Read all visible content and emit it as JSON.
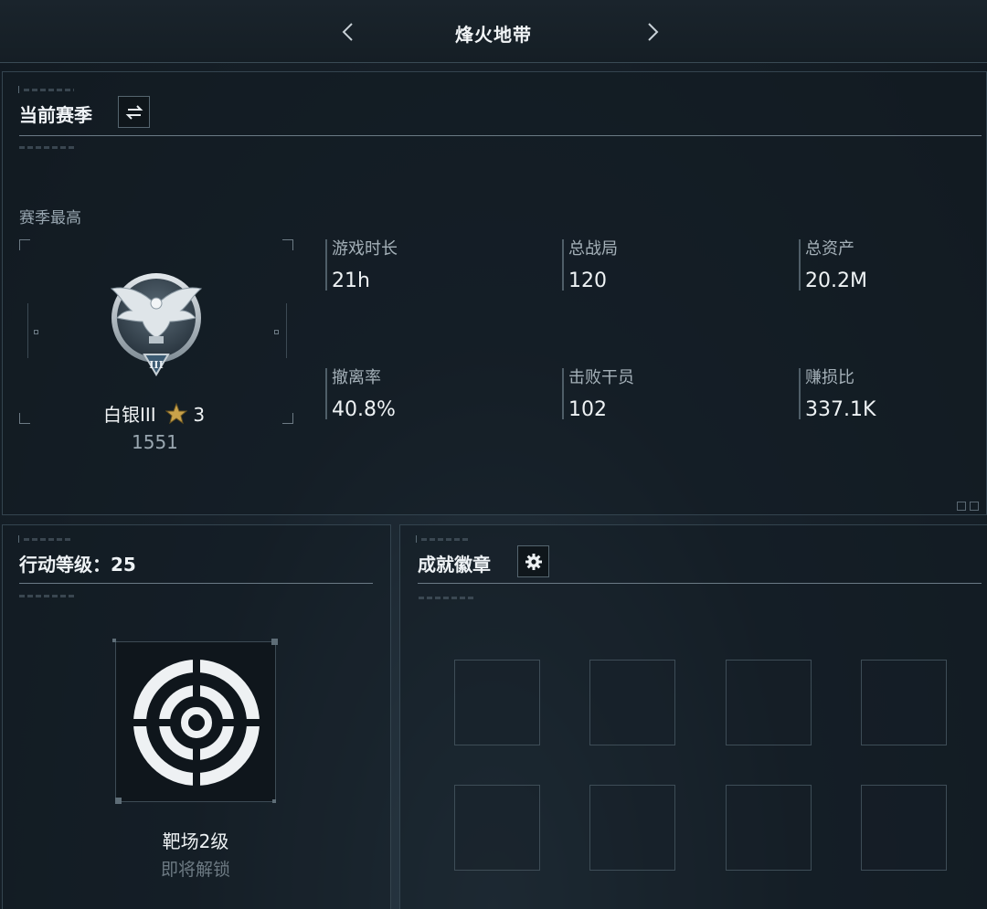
{
  "header": {
    "title": "烽火地带"
  },
  "season": {
    "title": "当前赛季",
    "best_label": "赛季最高",
    "rank": {
      "name": "白银III",
      "star_icon": "star-icon",
      "stars": "3",
      "score": "1551"
    },
    "stats": [
      {
        "label": "游戏时长",
        "value": "21h"
      },
      {
        "label": "总战局",
        "value": "120"
      },
      {
        "label": "总资产",
        "value": "20.2M"
      },
      {
        "label": "撤离率",
        "value": "40.8%"
      },
      {
        "label": "击败干员",
        "value": "102"
      },
      {
        "label": "赚损比",
        "value": "337.1K"
      }
    ]
  },
  "level": {
    "title": "行动等级：25",
    "unlock_name": "靶场2级",
    "unlock_status": "即将解锁"
  },
  "badges": {
    "title": "成就徽章",
    "slots": 8
  },
  "colors": {
    "background": "#151e25",
    "accent_gold": "#c9a24a",
    "text_muted": "#98a6b0"
  }
}
